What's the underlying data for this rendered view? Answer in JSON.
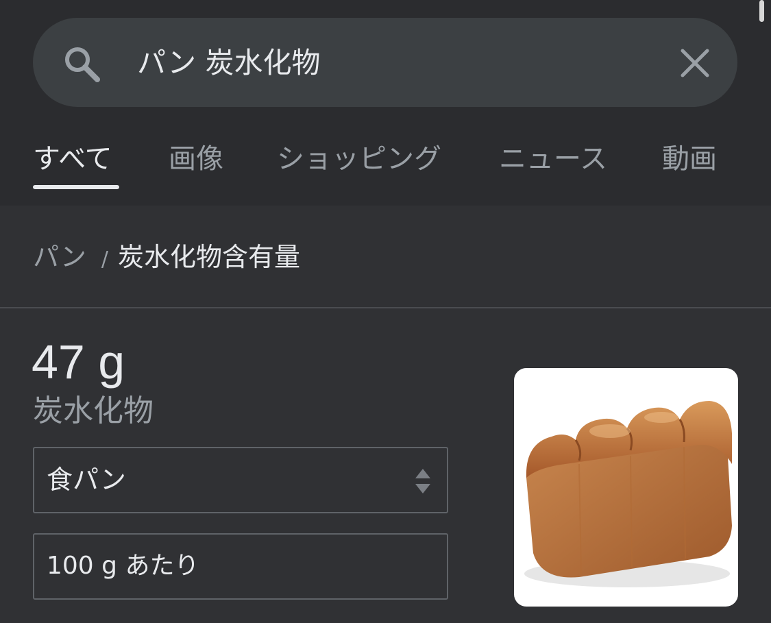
{
  "search": {
    "query": "パン 炭水化物",
    "search_icon": "search-icon",
    "clear_icon": "close-icon"
  },
  "tabs": [
    {
      "label": "すべて",
      "active": true
    },
    {
      "label": "画像",
      "active": false
    },
    {
      "label": "ショッピング",
      "active": false
    },
    {
      "label": "ニュース",
      "active": false
    },
    {
      "label": "動画",
      "active": false
    }
  ],
  "breadcrumb": {
    "parent": "パン",
    "separator": "/",
    "current": "炭水化物含有量"
  },
  "nutrition": {
    "value": "47 g",
    "label": "炭水化物",
    "food_select": "食パン",
    "serving": "100 g あたり",
    "image": "bread-loaf"
  },
  "colors": {
    "background": "#303134",
    "search_bar": "#3c4043",
    "text_primary": "#e8eaed",
    "text_secondary": "#9aa0a6",
    "border": "#5f6368"
  }
}
